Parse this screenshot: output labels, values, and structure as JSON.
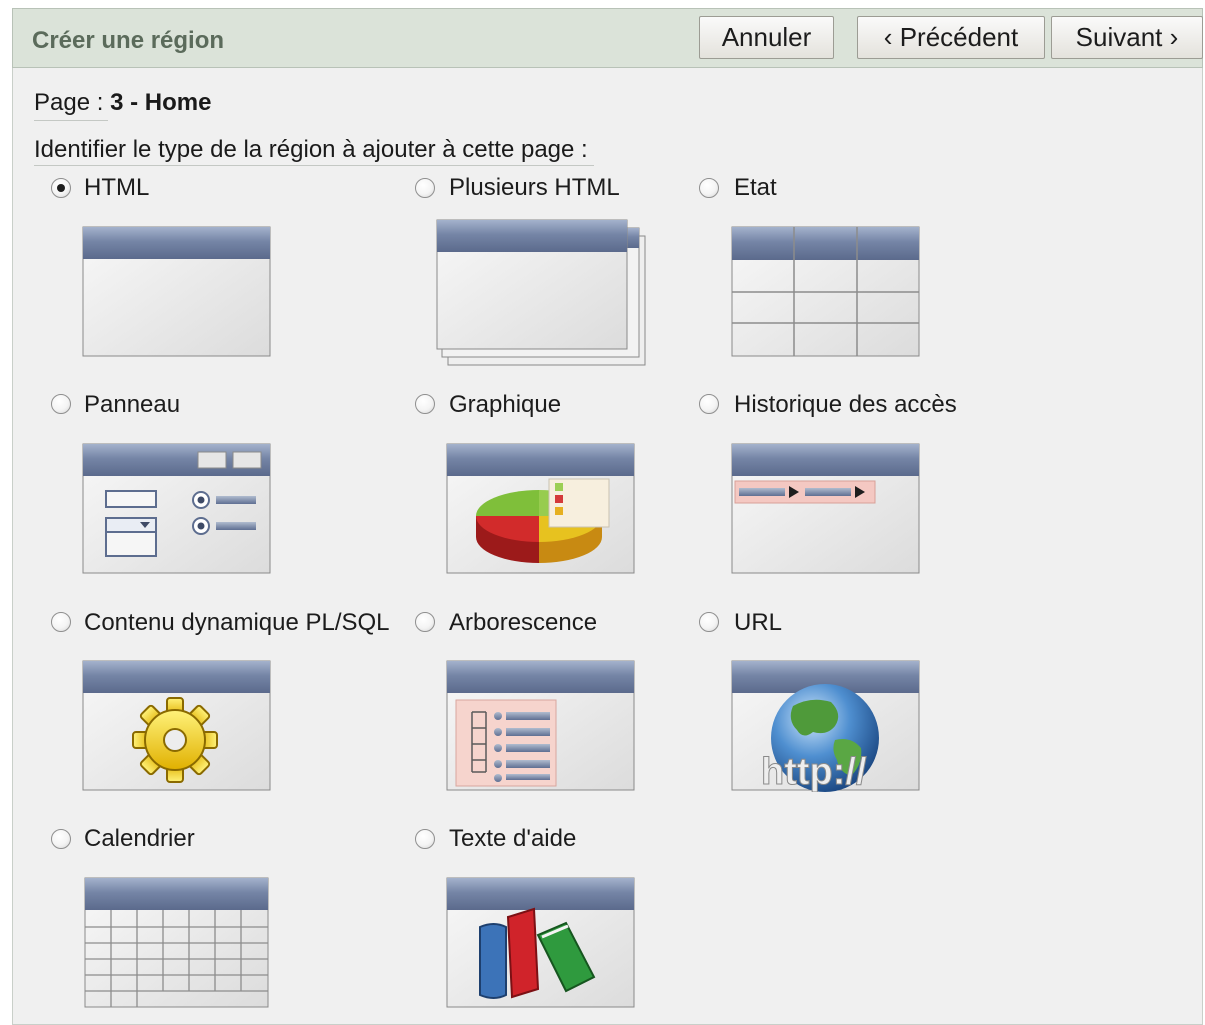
{
  "header": {
    "title": "Créer une région",
    "cancel_label": "Annuler",
    "previous_label": "Précédent",
    "next_label": "Suivant"
  },
  "page_info": {
    "label": "Page :",
    "value": "3 - Home"
  },
  "instruction": "Identifier le type de la région à ajouter à cette page :",
  "region_types": [
    {
      "label": "HTML",
      "checked": true,
      "icon": "html-region-icon"
    },
    {
      "label": "Plusieurs HTML",
      "checked": false,
      "icon": "multiple-html-region-icon"
    },
    {
      "label": "Etat",
      "checked": false,
      "icon": "report-region-icon"
    },
    {
      "label": "Panneau",
      "checked": false,
      "icon": "form-panel-region-icon"
    },
    {
      "label": "Graphique",
      "checked": false,
      "icon": "pie-chart-region-icon"
    },
    {
      "label": "Historique des accès",
      "checked": false,
      "icon": "breadcrumb-history-region-icon"
    },
    {
      "label": "Contenu dynamique PL/SQL",
      "checked": false,
      "icon": "gear-region-icon"
    },
    {
      "label": "Arborescence",
      "checked": false,
      "icon": "tree-region-icon"
    },
    {
      "label": "URL",
      "checked": false,
      "icon": "globe-url-region-icon"
    },
    {
      "label": "Calendrier",
      "checked": false,
      "icon": "calendar-region-icon"
    },
    {
      "label": "Texte d'aide",
      "checked": false,
      "icon": "books-help-region-icon"
    }
  ],
  "url_thumbnail_text": "http://",
  "colors": {
    "title_bar": "#dbe3d9",
    "panel_bg": "#f0f0f0",
    "thumb_header": "#6f7fa0"
  }
}
